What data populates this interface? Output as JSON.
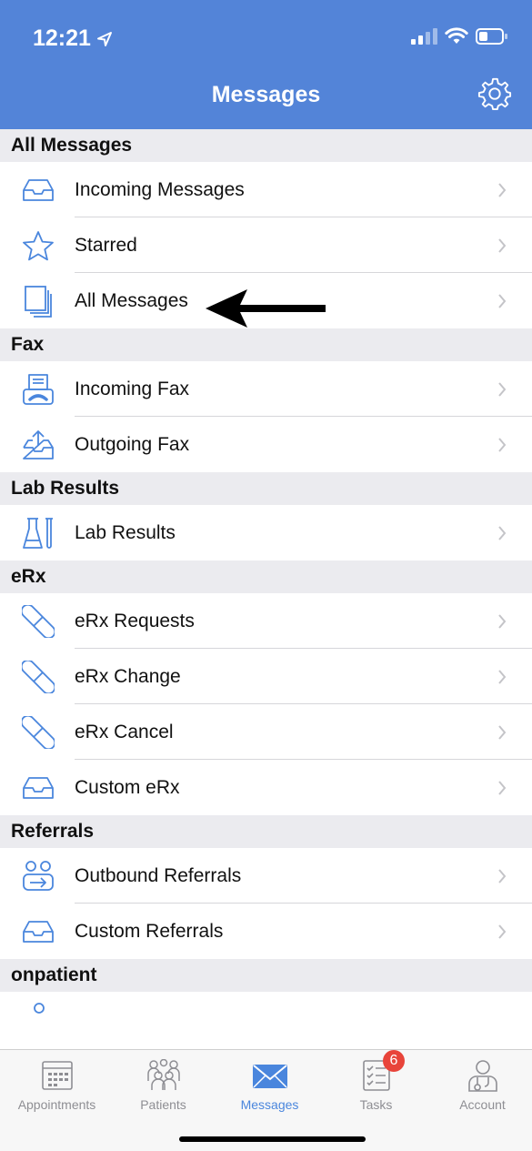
{
  "status_bar": {
    "time": "12:21"
  },
  "nav": {
    "title": "Messages"
  },
  "sections": [
    {
      "title": "All Messages",
      "items": [
        {
          "label": "Incoming Messages",
          "icon": "inbox-tray-icon"
        },
        {
          "label": "Starred",
          "icon": "star-icon"
        },
        {
          "label": "All Messages",
          "icon": "stacked-pages-icon"
        }
      ]
    },
    {
      "title": "Fax",
      "items": [
        {
          "label": "Incoming Fax",
          "icon": "fax-icon"
        },
        {
          "label": "Outgoing Fax",
          "icon": "outbox-tray-icon"
        }
      ]
    },
    {
      "title": "Lab Results",
      "items": [
        {
          "label": "Lab Results",
          "icon": "flask-icon"
        }
      ]
    },
    {
      "title": "eRx",
      "items": [
        {
          "label": "eRx Requests",
          "icon": "pill-icon"
        },
        {
          "label": "eRx Change",
          "icon": "pill-icon"
        },
        {
          "label": "eRx Cancel",
          "icon": "pill-icon"
        },
        {
          "label": "Custom eRx",
          "icon": "inbox-tray-icon"
        }
      ]
    },
    {
      "title": "Referrals",
      "items": [
        {
          "label": "Outbound Referrals",
          "icon": "referral-people-icon"
        },
        {
          "label": "Custom Referrals",
          "icon": "inbox-tray-icon"
        }
      ]
    },
    {
      "title": "onpatient",
      "items": []
    }
  ],
  "tabs": [
    {
      "label": "Appointments",
      "icon": "calendar-icon",
      "active": false
    },
    {
      "label": "Patients",
      "icon": "patients-icon",
      "active": false
    },
    {
      "label": "Messages",
      "icon": "envelope-icon",
      "active": true
    },
    {
      "label": "Tasks",
      "icon": "checklist-icon",
      "active": false,
      "badge": "6"
    },
    {
      "label": "Account",
      "icon": "doctor-icon",
      "active": false
    }
  ],
  "colors": {
    "header_bg": "#5384D8",
    "accent": "#4A86DD",
    "section_bg": "#EBEBEF",
    "badge": "#E8443A"
  }
}
